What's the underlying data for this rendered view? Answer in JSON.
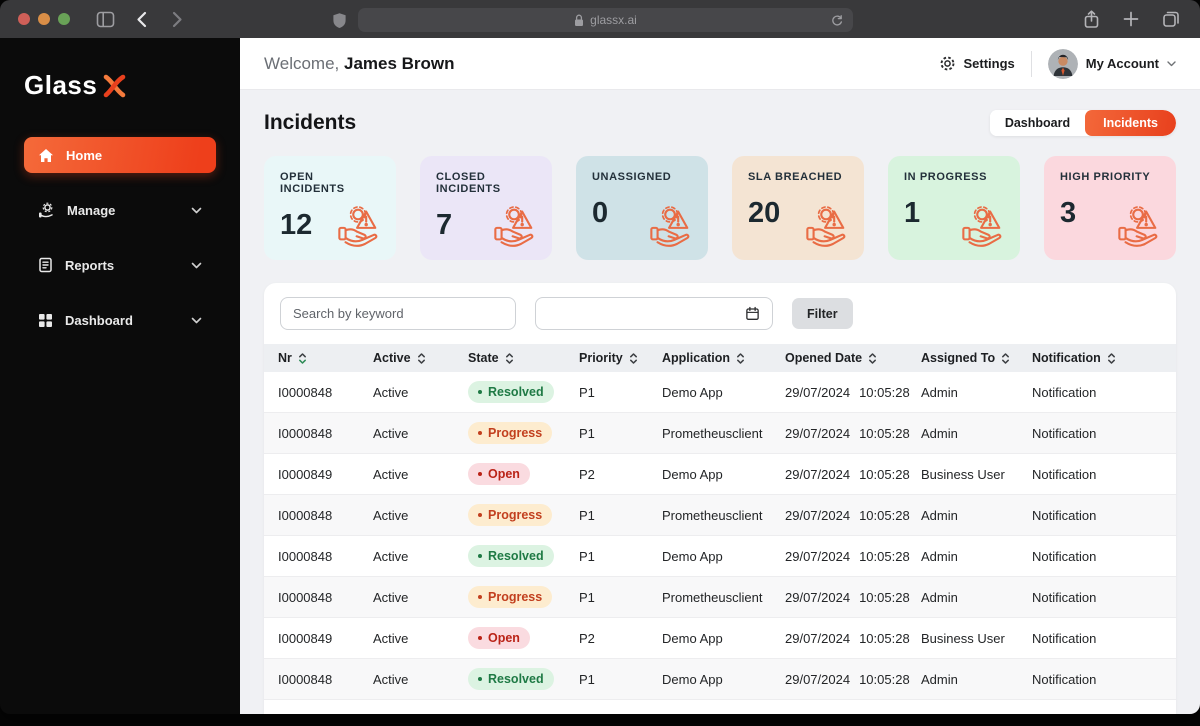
{
  "browser": {
    "url": "glassx.ai",
    "traffic_lights": {
      "close": "#cf5f58",
      "minimize": "#d98e47",
      "zoom": "#69a257"
    }
  },
  "sidebar": {
    "logo_text": "Glass",
    "items": [
      {
        "label": "Home",
        "icon": "home-icon",
        "active": true
      },
      {
        "label": "Manage",
        "icon": "manage-icon",
        "active": false
      },
      {
        "label": "Reports",
        "icon": "reports-icon",
        "active": false
      },
      {
        "label": "Dashboard",
        "icon": "dashboard-icon",
        "active": false
      }
    ]
  },
  "header": {
    "welcome_prefix": "Welcome,",
    "user_name": "James Brown",
    "settings_label": "Settings",
    "account_label": "My Account"
  },
  "page": {
    "title": "Incidents",
    "toggle": [
      {
        "label": "Dashboard",
        "active": false
      },
      {
        "label": "Incidents",
        "active": true
      }
    ]
  },
  "stats": [
    {
      "label": "OPEN INCIDENTS",
      "value": "12",
      "bg": "#e9f7f8"
    },
    {
      "label": "CLOSED INCIDENTS",
      "value": "7",
      "bg": "#ebe6f7"
    },
    {
      "label": "UNASSIGNED",
      "value": "0",
      "bg": "#cfe2e7"
    },
    {
      "label": "SLA BREACHED",
      "value": "20",
      "bg": "#f4e4d3"
    },
    {
      "label": "IN PROGRESS",
      "value": "1",
      "bg": "#d8f3de"
    },
    {
      "label": "HIGH PRIORITY",
      "value": "3",
      "bg": "#fbd8de"
    }
  ],
  "filters": {
    "search_placeholder": "Search by keyword",
    "filter_label": "Filter"
  },
  "table": {
    "columns": [
      "Nr",
      "Active",
      "State",
      "Priority",
      "Application",
      "Opened Date",
      "Assigned To",
      "Notification"
    ],
    "rows": [
      {
        "nr": "I0000848",
        "active": "Active",
        "state": "Resolved",
        "priority": "P1",
        "application": "Demo App",
        "opened_date": "29/07/2024",
        "opened_time": "10:05:28",
        "assigned": "Admin",
        "notification": "Notification"
      },
      {
        "nr": "I0000848",
        "active": "Active",
        "state": "Progress",
        "priority": "P1",
        "application": "Prometheusclient",
        "opened_date": "29/07/2024",
        "opened_time": "10:05:28",
        "assigned": "Admin",
        "notification": "Notification"
      },
      {
        "nr": "I0000849",
        "active": "Active",
        "state": "Open",
        "priority": "P2",
        "application": "Demo App",
        "opened_date": "29/07/2024",
        "opened_time": "10:05:28",
        "assigned": "Business User",
        "notification": "Notification"
      },
      {
        "nr": "I0000848",
        "active": "Active",
        "state": "Progress",
        "priority": "P1",
        "application": "Prometheusclient",
        "opened_date": "29/07/2024",
        "opened_time": "10:05:28",
        "assigned": "Admin",
        "notification": "Notification"
      },
      {
        "nr": "I0000848",
        "active": "Active",
        "state": "Resolved",
        "priority": "P1",
        "application": "Demo App",
        "opened_date": "29/07/2024",
        "opened_time": "10:05:28",
        "assigned": "Admin",
        "notification": "Notification"
      },
      {
        "nr": "I0000848",
        "active": "Active",
        "state": "Progress",
        "priority": "P1",
        "application": "Prometheusclient",
        "opened_date": "29/07/2024",
        "opened_time": "10:05:28",
        "assigned": "Admin",
        "notification": "Notification"
      },
      {
        "nr": "I0000849",
        "active": "Active",
        "state": "Open",
        "priority": "P2",
        "application": "Demo App",
        "opened_date": "29/07/2024",
        "opened_time": "10:05:28",
        "assigned": "Business User",
        "notification": "Notification"
      },
      {
        "nr": "I0000848",
        "active": "Active",
        "state": "Resolved",
        "priority": "P1",
        "application": "Demo App",
        "opened_date": "29/07/2024",
        "opened_time": "10:05:28",
        "assigned": "Admin",
        "notification": "Notification"
      }
    ]
  },
  "colors": {
    "accent_orange": "#ee4420",
    "state_resolved_bg": "#dcf3e2",
    "state_resolved_text": "#1f7a45",
    "state_progress_bg": "#fdeccf",
    "state_progress_text": "#c23f1e",
    "state_open_bg": "#fadbe0",
    "state_open_text": "#ba2317"
  }
}
